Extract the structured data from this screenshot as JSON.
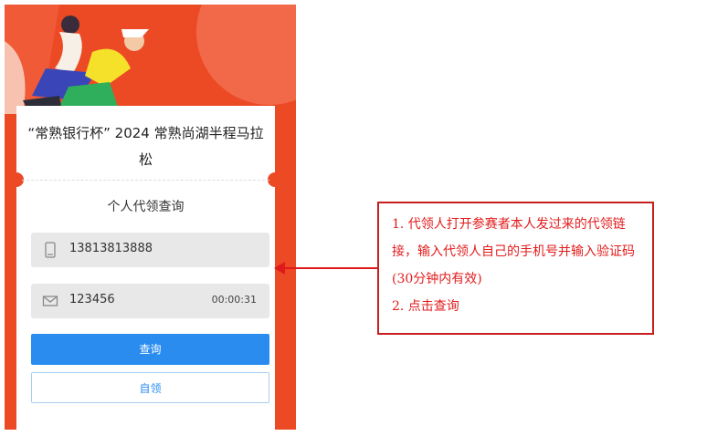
{
  "event": {
    "title": "“常熟银行杯” 2024 常熟尚湖半程马拉松"
  },
  "page": {
    "subtitle": "个人代领查询"
  },
  "form": {
    "phone_value": "13813813888",
    "code_value": "123456",
    "countdown": "00:00:31"
  },
  "buttons": {
    "query_label": "查询",
    "self_claim_label": "自领"
  },
  "annotation": {
    "lines": [
      "1. 代领人打开参赛者本人发过来的代领链接，输入代领人自己的手机号并输入验证码(30分钟内有效)",
      "2. 点击查询"
    ]
  },
  "colors": {
    "brand_red": "#ec4a25",
    "primary_blue": "#2b8cf0",
    "annotation_red": "#e21c1c"
  },
  "icons": [
    "phone-icon",
    "mail-icon"
  ]
}
